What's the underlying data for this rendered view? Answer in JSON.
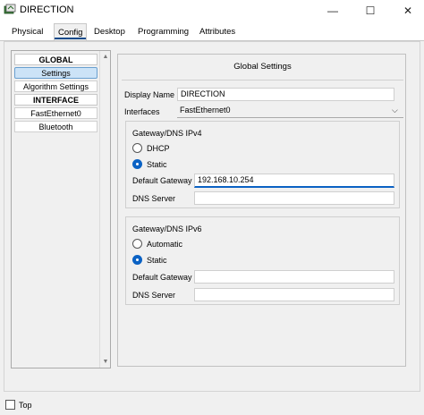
{
  "window": {
    "title": "DIRECTION",
    "minimize_glyph": "—",
    "maximize_glyph": "☐",
    "close_glyph": "✕"
  },
  "tabs": [
    {
      "label": "Physical"
    },
    {
      "label": "Config"
    },
    {
      "label": "Desktop"
    },
    {
      "label": "Programming"
    },
    {
      "label": "Attributes"
    }
  ],
  "active_tab": "Config",
  "sidebar": {
    "items": [
      {
        "label": "GLOBAL",
        "kind": "header"
      },
      {
        "label": "Settings",
        "kind": "item",
        "selected": true
      },
      {
        "label": "Algorithm Settings",
        "kind": "item"
      },
      {
        "label": "INTERFACE",
        "kind": "header"
      },
      {
        "label": "FastEthernet0",
        "kind": "item"
      },
      {
        "label": "Bluetooth",
        "kind": "item"
      }
    ],
    "scroll_up": "▲",
    "scroll_down": "▼"
  },
  "global_settings": {
    "title": "Global Settings",
    "display_name_label": "Display Name",
    "display_name_value": "DIRECTION",
    "interfaces_label": "Interfaces",
    "interfaces_value": "FastEthernet0",
    "chevron": "⌵"
  },
  "ipv4": {
    "title": "Gateway/DNS IPv4",
    "dhcp_label": "DHCP",
    "static_label": "Static",
    "selected": "Static",
    "default_gateway_label": "Default Gateway",
    "default_gateway_value": "192.168.10.254",
    "dns_server_label": "DNS Server",
    "dns_server_value": ""
  },
  "ipv6": {
    "title": "Gateway/DNS IPv6",
    "automatic_label": "Automatic",
    "static_label": "Static",
    "selected": "Static",
    "default_gateway_label": "Default Gateway",
    "default_gateway_value": "",
    "dns_server_label": "DNS Server",
    "dns_server_value": ""
  },
  "footer": {
    "top_label": "Top"
  },
  "colors": {
    "accent": "#0b62c4",
    "tab_underline": "#0b4a8a",
    "selected_item": "#cce3f7"
  }
}
